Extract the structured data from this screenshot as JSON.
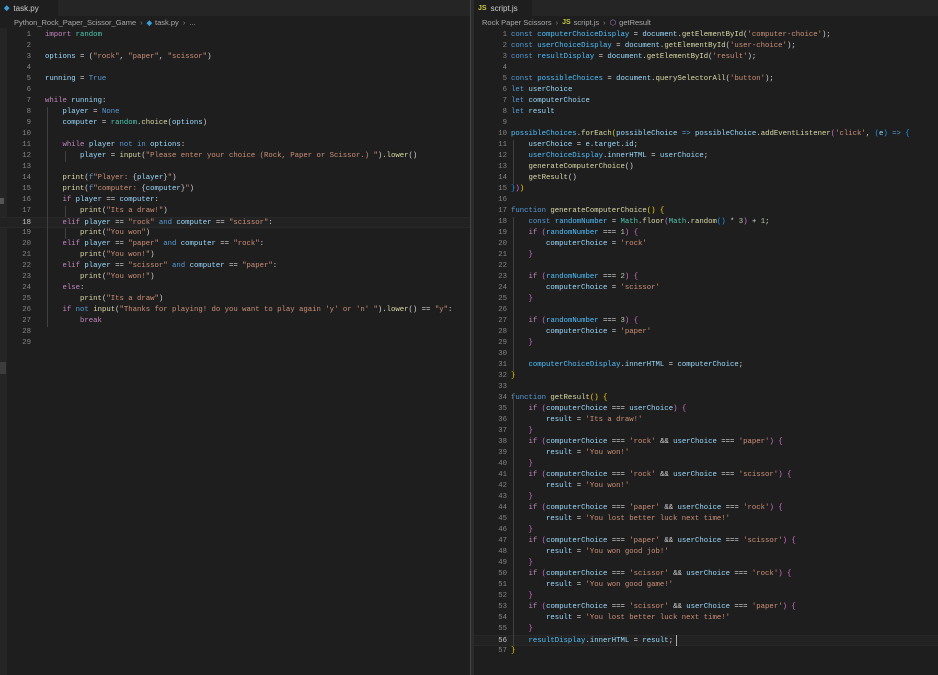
{
  "left_pane": {
    "tab_label": "task.py",
    "breadcrumb": [
      "Python_Rock_Paper_Scissor_Game",
      "task.py",
      "..."
    ],
    "current_line": 18,
    "lines": [
      "<span class=\"kw\">import</span> <span class=\"tp\">random</span>",
      "",
      "<span class=\"vr\">options</span> = (<span class=\"st\">\"rock\"</span>, <span class=\"st\">\"paper\"</span>, <span class=\"st\">\"scissor\"</span>)",
      "",
      "<span class=\"vr\">running</span> = <span class=\"bl\">True</span>",
      "",
      "<span class=\"kw\">while</span> <span class=\"vr\">running</span>:",
      "    <span class=\"vr\">player</span> = <span class=\"bl\">None</span>",
      "    <span class=\"vr\">computer</span> = <span class=\"tp\">random</span>.<span class=\"fn\">choice</span>(<span class=\"vr\">options</span>)",
      "",
      "    <span class=\"kw\">while</span> <span class=\"vr\">player</span> <span class=\"bl\">not in</span> <span class=\"vr\">options</span>:",
      "        <span class=\"vr\">player</span> = <span class=\"fn\">input</span>(<span class=\"st\">\"Please enter your choice (Rock, Paper or Scissor.) \"</span>).<span class=\"fn\">lower</span>()",
      "",
      "    <span class=\"fn\">print</span>(<span class=\"bl\">f</span><span class=\"st\">\"Player: </span>{<span class=\"vr\">player</span>}<span class=\"st\">\"</span>)",
      "    <span class=\"fn\">print</span>(<span class=\"bl\">f</span><span class=\"st\">\"computer: </span>{<span class=\"vr\">computer</span>}<span class=\"st\">\"</span>)",
      "    <span class=\"kw\">if</span> <span class=\"vr\">player</span> == <span class=\"vr\">computer</span>:",
      "        <span class=\"fn\">print</span>(<span class=\"st\">\"Its a draw!\"</span>)",
      "    <span class=\"kw\">elif</span> <span class=\"vr\">player</span> == <span class=\"st\">\"rock\"</span> <span class=\"bl\">and</span> <span class=\"vr\">computer</span> == <span class=\"st\">\"scissor\"</span>:",
      "        <span class=\"fn\">print</span>(<span class=\"st\">\"You won\"</span>)",
      "    <span class=\"kw\">elif</span> <span class=\"vr\">player</span> == <span class=\"st\">\"paper\"</span> <span class=\"bl\">and</span> <span class=\"vr\">computer</span> == <span class=\"st\">\"rock\"</span>:",
      "        <span class=\"fn\">print</span>(<span class=\"st\">\"You won!\"</span>)",
      "    <span class=\"kw\">elif</span> <span class=\"vr\">player</span> == <span class=\"st\">\"scissor\"</span> <span class=\"bl\">and</span> <span class=\"vr\">computer</span> == <span class=\"st\">\"paper\"</span>:",
      "        <span class=\"fn\">print</span>(<span class=\"st\">\"You won!\"</span>)",
      "    <span class=\"kw\">else</span>:",
      "        <span class=\"fn\">print</span>(<span class=\"st\">\"Its a draw\"</span>)",
      "    <span class=\"kw\">if</span> <span class=\"bl\">not</span> <span class=\"fn\">input</span>(<span class=\"st\">\"Thanks for playing! do you want to play again 'y' or 'n' \"</span>).<span class=\"fn\">lower</span>() == <span class=\"st\">\"y\"</span>:",
      "        <span class=\"kw\">break</span>",
      "",
      ""
    ]
  },
  "right_pane": {
    "tab_label": "script.js",
    "breadcrumb": [
      "Rock Paper Scissors",
      "script.js",
      "getResult"
    ],
    "current_line": 56,
    "lines": [
      "<span class=\"bl\">const</span> <span class=\"cn\">computerChoiceDisplay</span> = <span class=\"vr\">document</span>.<span class=\"fn\">getElementById</span>(<span class=\"st\">'computer-choice'</span>);",
      "<span class=\"bl\">const</span> <span class=\"cn\">userChoiceDisplay</span> = <span class=\"vr\">document</span>.<span class=\"fn\">getElementById</span>(<span class=\"st\">'user-choice'</span>);",
      "<span class=\"bl\">const</span> <span class=\"cn\">resultDisplay</span> = <span class=\"vr\">document</span>.<span class=\"fn\">getElementById</span>(<span class=\"st\">'result'</span>);",
      "",
      "<span class=\"bl\">const</span> <span class=\"cn\">possibleChoices</span> = <span class=\"vr\">document</span>.<span class=\"fn\">querySelectorAll</span>(<span class=\"st\">'button'</span>);",
      "<span class=\"bl\">let</span> <span class=\"vr\">userChoice</span>",
      "<span class=\"bl\">let</span> <span class=\"vr\">computerChoice</span>",
      "<span class=\"bl\">let</span> <span class=\"vr\">result</span>",
      "",
      "<span class=\"cn\">possibleChoices</span>.<span class=\"fn\">forEach</span><span class=\"br1\">(</span><span class=\"vr\">possibleChoice</span> <span class=\"bl\">=&gt;</span> <span class=\"vr\">possibleChoice</span>.<span class=\"fn\">addEventListener</span><span class=\"br2\">(</span><span class=\"st\">'click'</span>, <span class=\"br3\">(</span><span class=\"vr\">e</span><span class=\"br3\">)</span> <span class=\"bl\">=&gt;</span> <span class=\"br3\">{</span>",
      "    <span class=\"vr\">userChoice</span> = <span class=\"vr\">e</span>.<span class=\"vr\">target</span>.<span class=\"vr\">id</span>;",
      "    <span class=\"cn\">userChoiceDisplay</span>.<span class=\"vr\">innerHTML</span> = <span class=\"vr\">userChoice</span>;",
      "    <span class=\"fn\">generateComputerChoice</span>()",
      "    <span class=\"fn\">getResult</span>()",
      "<span class=\"br3\">}</span><span class=\"br2\">)</span><span class=\"br1\">)</span>",
      "",
      "<span class=\"bl\">function</span> <span class=\"fn\">generateComputerChoice</span><span class=\"br1\">()</span> <span class=\"br1\">{</span>",
      "    <span class=\"bl\">const</span> <span class=\"cn\">randomNumber</span> = <span class=\"tp\">Math</span>.<span class=\"fn\">floor</span><span class=\"br2\">(</span><span class=\"tp\">Math</span>.<span class=\"fn\">random</span><span class=\"br3\">()</span> * <span class=\"nm\">3</span><span class=\"br2\">)</span> + <span class=\"nm\">1</span>;",
      "    <span class=\"kw\">if</span> <span class=\"br2\">(</span><span class=\"cn\">randomNumber</span> === <span class=\"nm\">1</span><span class=\"br2\">)</span> <span class=\"br2\">{</span>",
      "        <span class=\"vr\">computerChoice</span> = <span class=\"st\">'rock'</span>",
      "    <span class=\"br2\">}</span>",
      "",
      "    <span class=\"kw\">if</span> <span class=\"br2\">(</span><span class=\"cn\">randomNumber</span> === <span class=\"nm\">2</span><span class=\"br2\">)</span> <span class=\"br2\">{</span>",
      "        <span class=\"vr\">computerChoice</span> = <span class=\"st\">'scissor'</span>",
      "    <span class=\"br2\">}</span>",
      "",
      "    <span class=\"kw\">if</span> <span class=\"br2\">(</span><span class=\"cn\">randomNumber</span> === <span class=\"nm\">3</span><span class=\"br2\">)</span> <span class=\"br2\">{</span>",
      "        <span class=\"vr\">computerChoice</span> = <span class=\"st\">'paper'</span>",
      "    <span class=\"br2\">}</span>",
      "",
      "    <span class=\"cn\">computerChoiceDisplay</span>.<span class=\"vr\">innerHTML</span> = <span class=\"vr\">computerChoice</span>;",
      "<span class=\"br1\">}</span>",
      "",
      "<span class=\"bl\">function</span> <span class=\"fn\">getResult</span><span class=\"br1\">()</span> <span class=\"br1\">{</span>",
      "    <span class=\"kw\">if</span> <span class=\"br2\">(</span><span class=\"vr\">computerChoice</span> === <span class=\"vr\">userChoice</span><span class=\"br2\">)</span> <span class=\"br2\">{</span>",
      "        <span class=\"vr\">result</span> = <span class=\"st\">'Its a draw!'</span>",
      "    <span class=\"br2\">}</span>",
      "    <span class=\"kw\">if</span> <span class=\"br2\">(</span><span class=\"vr\">computerChoice</span> === <span class=\"st\">'rock'</span> &amp;&amp; <span class=\"vr\">userChoice</span> === <span class=\"st\">'paper'</span><span class=\"br2\">)</span> <span class=\"br2\">{</span>",
      "        <span class=\"vr\">result</span> = <span class=\"st\">'You won!'</span>",
      "    <span class=\"br2\">}</span>",
      "    <span class=\"kw\">if</span> <span class=\"br2\">(</span><span class=\"vr\">computerChoice</span> === <span class=\"st\">'rock'</span> &amp;&amp; <span class=\"vr\">userChoice</span> === <span class=\"st\">'scissor'</span><span class=\"br2\">)</span> <span class=\"br2\">{</span>",
      "        <span class=\"vr\">result</span> = <span class=\"st\">'You won!'</span>",
      "    <span class=\"br2\">}</span>",
      "    <span class=\"kw\">if</span> <span class=\"br2\">(</span><span class=\"vr\">computerChoice</span> === <span class=\"st\">'paper'</span> &amp;&amp; <span class=\"vr\">userChoice</span> === <span class=\"st\">'rock'</span><span class=\"br2\">)</span> <span class=\"br2\">{</span>",
      "        <span class=\"vr\">result</span> = <span class=\"st\">'You lost better luck next time!'</span>",
      "    <span class=\"br2\">}</span>",
      "    <span class=\"kw\">if</span> <span class=\"br2\">(</span><span class=\"vr\">computerChoice</span> === <span class=\"st\">'paper'</span> &amp;&amp; <span class=\"vr\">userChoice</span> === <span class=\"st\">'scissor'</span><span class=\"br2\">)</span> <span class=\"br2\">{</span>",
      "        <span class=\"vr\">result</span> = <span class=\"st\">'You won good job!'</span>",
      "    <span class=\"br2\">}</span>",
      "    <span class=\"kw\">if</span> <span class=\"br2\">(</span><span class=\"vr\">computerChoice</span> === <span class=\"st\">'scissor'</span> &amp;&amp; <span class=\"vr\">userChoice</span> === <span class=\"st\">'rock'</span><span class=\"br2\">)</span> <span class=\"br2\">{</span>",
      "        <span class=\"vr\">result</span> = <span class=\"st\">'You won good game!'</span>",
      "    <span class=\"br2\">}</span>",
      "    <span class=\"kw\">if</span> <span class=\"br2\">(</span><span class=\"vr\">computerChoice</span> === <span class=\"st\">'scissor'</span> &amp;&amp; <span class=\"vr\">userChoice</span> === <span class=\"st\">'paper'</span><span class=\"br2\">)</span> <span class=\"br2\">{</span>",
      "        <span class=\"vr\">result</span> = <span class=\"st\">'You lost better luck next time!'</span>",
      "    <span class=\"br2\">}</span>",
      "    <span class=\"cn\">resultDisplay</span>.<span class=\"vr\">innerHTML</span> = <span class=\"vr\">result</span>;",
      "<span class=\"br1\">}</span>"
    ]
  },
  "icons": {
    "python_file": "python-file-icon",
    "js_file": "js-file-icon",
    "function_symbol": "cube-icon",
    "separator": "chevron-right-icon"
  },
  "colors": {
    "background": "#1e1e1e",
    "keyword": "#c586c0",
    "string": "#ce9178",
    "function": "#dcdcaa",
    "variable": "#9cdcfe"
  }
}
